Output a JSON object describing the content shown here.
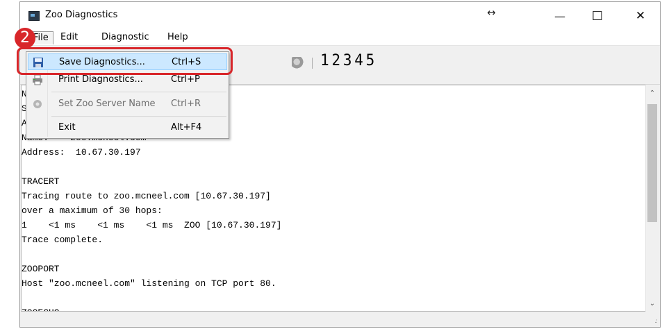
{
  "window": {
    "title": "Zoo Diagnostics",
    "resize_glyph": "↔",
    "minimize": "—",
    "maximize": "☐",
    "close": "✕"
  },
  "menubar": {
    "items": [
      "File",
      "Edit",
      "Diagnostic",
      "Help"
    ]
  },
  "toolbar": {
    "digits": "12345"
  },
  "file_menu": {
    "items": [
      {
        "label": "Save Diagnostics...",
        "shortcut": "Ctrl+S",
        "icon": "floppy-disk-icon"
      },
      {
        "label": "Print Diagnostics...",
        "shortcut": "Ctrl+P",
        "icon": "printer-icon"
      },
      {
        "label": "Set Zoo Server Name",
        "shortcut": "Ctrl+R",
        "icon": "server-settings-icon"
      },
      {
        "label": "Exit",
        "shortcut": "Alt+F4"
      }
    ]
  },
  "annotation": {
    "step": "2"
  },
  "log": {
    "lines": [
      "N",
      "S",
      "A",
      "Name:    zoo.mcneel.com",
      "Address:  10.67.30.197",
      "",
      "TRACERT",
      "Tracing route to zoo.mcneel.com [10.67.30.197]",
      "over a maximum of 30 hops:",
      "1    <1 ms    <1 ms    <1 ms  ZOO [10.67.30.197]",
      "Trace complete.",
      "",
      "ZOOPORT",
      "Host \"zoo.mcneel.com\" listening on TCP port 80.",
      "",
      "ZOOECHO"
    ]
  },
  "colors": {
    "highlight": "#cce8ff",
    "annotation_red": "#d8262a"
  }
}
